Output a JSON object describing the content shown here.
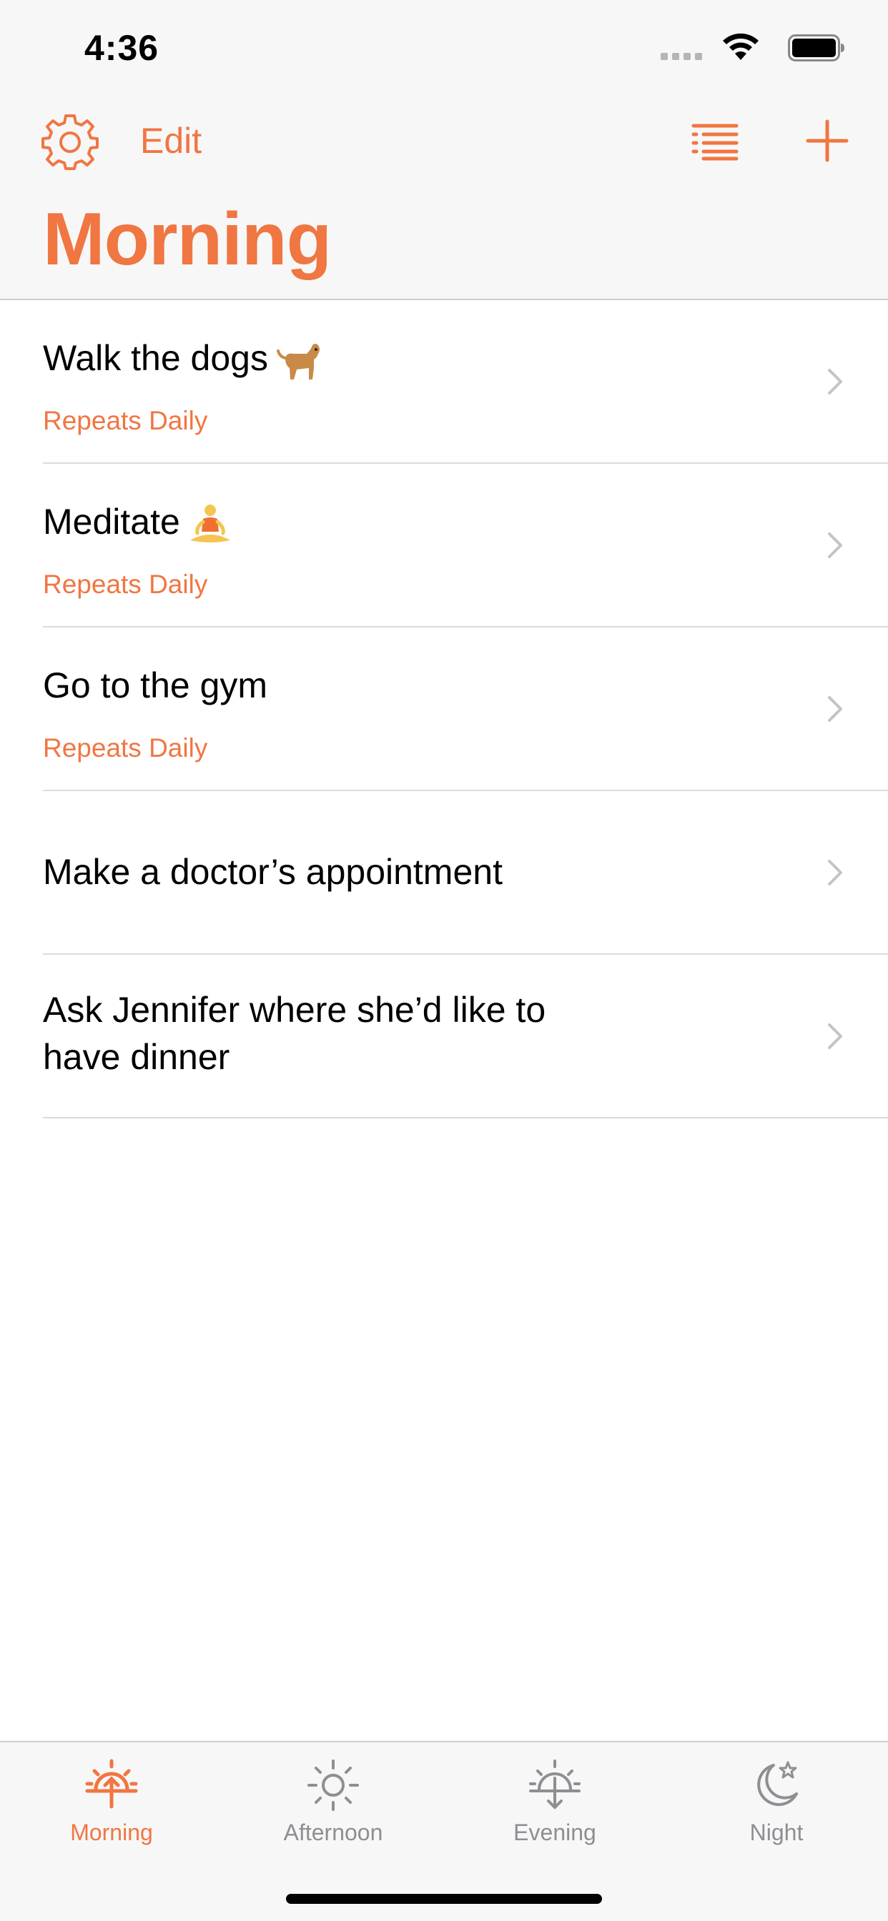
{
  "status_bar": {
    "time": "4:36"
  },
  "nav": {
    "edit_label": "Edit",
    "title": "Morning"
  },
  "items": [
    {
      "title": "Walk the dogs",
      "emoji": "dog",
      "subtitle": "Repeats Daily"
    },
    {
      "title": "Meditate",
      "emoji": "person-in-lotus-position",
      "subtitle": "Repeats Daily"
    },
    {
      "title": "Go to the gym",
      "subtitle": "Repeats Daily"
    },
    {
      "title": "Make a doctor’s appointment",
      "subtitle": ""
    },
    {
      "title": "Ask Jennifer where she’d like to have dinner",
      "subtitle": ""
    }
  ],
  "tabs": [
    {
      "label": "Morning",
      "icon": "sunrise-icon",
      "active": true
    },
    {
      "label": "Afternoon",
      "icon": "sun-icon",
      "active": false
    },
    {
      "label": "Evening",
      "icon": "sunset-icon",
      "active": false
    },
    {
      "label": "Night",
      "icon": "moon-stars-icon",
      "active": false
    }
  ],
  "colors": {
    "accent": "#f07642",
    "inactive": "#8e8e93",
    "bar_background": "#f7f7f7"
  }
}
